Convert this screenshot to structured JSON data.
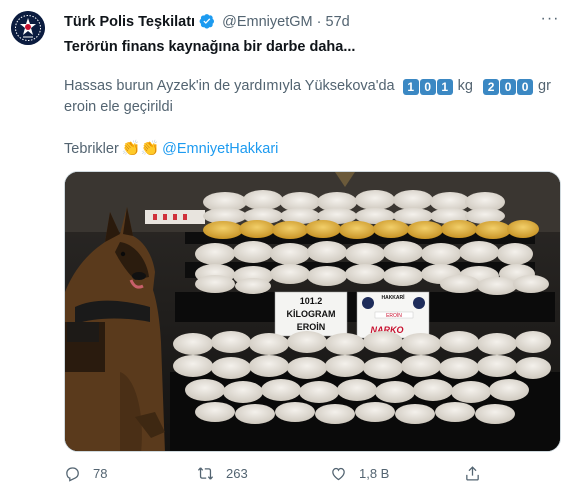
{
  "tweet": {
    "author_name": "Türk Polis Teşkilatı",
    "handle": "@EmniyetGM",
    "separator": "·",
    "time": "57d",
    "more_label": "···",
    "headline": "Terörün finans kaynağına bir darbe daha...",
    "body_prefix": "Hassas burun Ayzek'in de yardımıyla Yüksekova'da",
    "kg_digits": [
      "1",
      "0",
      "1"
    ],
    "kg_unit": "kg",
    "gr_digits": [
      "2",
      "0",
      "0"
    ],
    "gr_unit": "gr",
    "body_line2": "eroin ele geçirildi",
    "tebrik": "Tebrikler",
    "clap_emoji": "👏👏",
    "mention": "@EmniyetHakkari"
  },
  "media": {
    "label_line1": "101.2",
    "label_line2": "KİLOGRAM",
    "label_line3": "EROİN",
    "badge_top": "HAKKARİ",
    "badge_word": "EROİN",
    "badge_brand": "NARKO"
  },
  "actions": {
    "reply_count": "78",
    "retweet_count": "263",
    "like_count": "1,8 B"
  },
  "icons": {
    "reply": "comment-icon",
    "retweet": "retweet-icon",
    "like": "heart-icon",
    "share": "share-icon",
    "verified": "verified-badge-icon"
  },
  "colors": {
    "accent": "#1d9bf0",
    "text_primary": "#0f1419",
    "text_secondary": "#536471",
    "digit_box": "#3b88c3"
  }
}
